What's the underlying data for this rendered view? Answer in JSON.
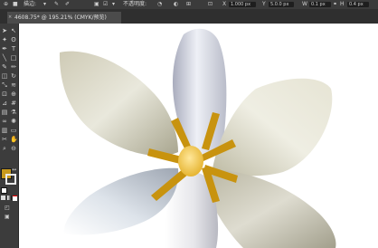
{
  "app": {
    "control_bar": {
      "style_label": "描边:",
      "stroke_weight": "▾",
      "opacity_label": "不透明度:",
      "field_x": "1.000 px",
      "field_y": "5.0.0 px",
      "field_w": "0.1 px",
      "field_h": "0.4 px"
    },
    "document_tab": {
      "title": "4608.75* @ 195.21% (CMYK/预览)",
      "close_icon": "×"
    },
    "colors": {
      "fill_swatch": "#c99a1d",
      "stroke_swatch": "#ffffff",
      "accent": "#b8860b"
    },
    "tools": {
      "items": [
        "selection-tool",
        "direct-selection-tool",
        "magic-wand-tool",
        "lasso-tool",
        "pen-tool",
        "type-tool",
        "line-tool",
        "rectangle-tool",
        "paintbrush-tool",
        "pencil-tool",
        "eraser-tool",
        "rotate-tool",
        "scale-tool",
        "warp-tool",
        "free-transform-tool",
        "shape-builder-tool",
        "perspective-grid-tool",
        "mesh-tool",
        "gradient-tool",
        "eyedropper-tool",
        "blend-tool",
        "symbol-sprayer-tool",
        "column-graph-tool",
        "artboard-tool",
        "slice-tool",
        "hand-tool",
        "zoom-tool"
      ]
    }
  }
}
